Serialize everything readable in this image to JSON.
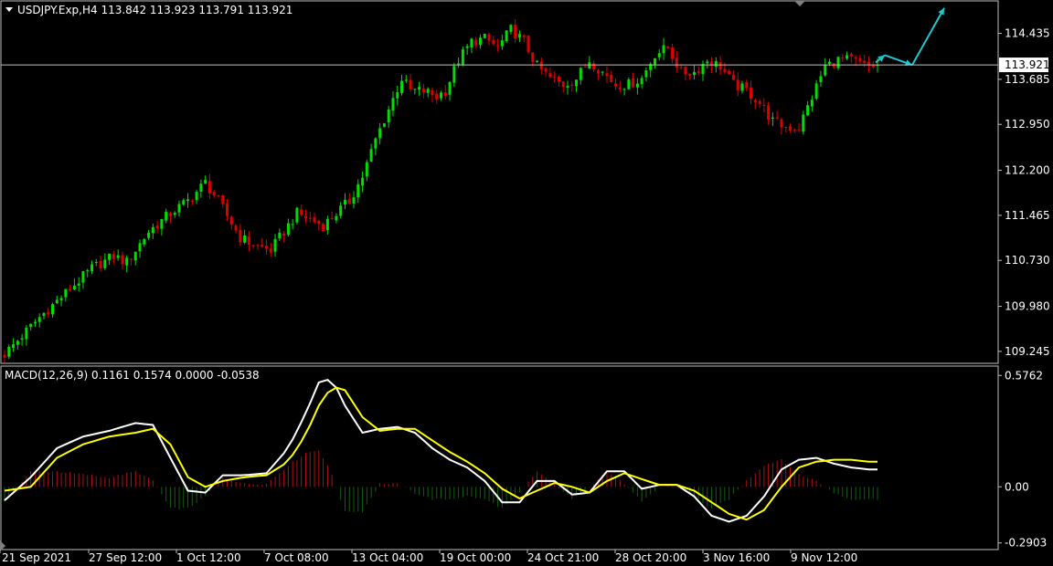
{
  "header": {
    "symbol_line": "USDJPY.Exp,H4  113.842 113.923 113.791 113.921"
  },
  "macd_header": "MACD(12,26,9) 0.1161 0.1574 0.0000 -0.0538",
  "price_label": "113.921",
  "colors": {
    "background": "#000000",
    "bull": "#00dd00",
    "bear": "#dd0000",
    "grid": "#c0c0c0",
    "arrow": "#1ec8d2",
    "macd_line": "#ffffff",
    "signal_line": "#ffff00",
    "hist_pos": "#b01010",
    "hist_neg": "#106010"
  },
  "chart_data": [
    {
      "type": "candlestick",
      "price_ticks": [
        "114.435",
        "113.685",
        "112.950",
        "112.200",
        "111.465",
        "110.730",
        "109.980",
        "109.245"
      ],
      "x_ticks": [
        "21 Sep 2021",
        "27 Sep 12:00",
        "1 Oct 12:00",
        "7 Oct 08:00",
        "13 Oct 04:00",
        "19 Oct 00:00",
        "24 Oct 21:00",
        "28 Oct 20:00",
        "3 Nov 16:00",
        "9 Nov 12:00"
      ],
      "ylim": [
        109.05,
        114.95
      ],
      "current_price": 113.921,
      "close_path": [
        [
          0,
          109.2
        ],
        [
          8,
          109.8
        ],
        [
          14,
          110.2
        ],
        [
          20,
          110.6
        ],
        [
          25,
          110.8
        ],
        [
          28,
          110.7
        ],
        [
          33,
          111.2
        ],
        [
          38,
          111.5
        ],
        [
          42,
          111.7
        ],
        [
          46,
          112.0
        ],
        [
          49,
          111.7
        ],
        [
          54,
          111.1
        ],
        [
          58,
          110.95
        ],
        [
          61,
          110.9
        ],
        [
          63,
          111.1
        ],
        [
          67,
          111.5
        ],
        [
          70,
          111.4
        ],
        [
          73,
          111.3
        ],
        [
          76,
          111.5
        ],
        [
          79,
          111.7
        ],
        [
          82,
          112.1
        ],
        [
          85,
          112.7
        ],
        [
          88,
          113.2
        ],
        [
          91,
          113.7
        ],
        [
          93,
          113.5
        ],
        [
          96,
          113.5
        ],
        [
          99,
          113.4
        ],
        [
          101,
          113.5
        ],
        [
          104,
          114.0
        ],
        [
          107,
          114.3
        ],
        [
          110,
          114.35
        ],
        [
          113,
          114.2
        ],
        [
          116,
          114.5
        ],
        [
          119,
          114.3
        ],
        [
          122,
          113.9
        ],
        [
          125,
          113.7
        ],
        [
          128,
          113.6
        ],
        [
          131,
          113.7
        ],
        [
          134,
          114.0
        ],
        [
          137,
          113.8
        ],
        [
          140,
          113.6
        ],
        [
          143,
          113.6
        ],
        [
          146,
          113.7
        ],
        [
          149,
          114.1
        ],
        [
          152,
          114.2
        ],
        [
          155,
          113.8
        ],
        [
          158,
          113.8
        ],
        [
          161,
          114.0
        ],
        [
          164,
          113.9
        ],
        [
          167,
          113.6
        ],
        [
          170,
          113.5
        ],
        [
          173,
          113.3
        ],
        [
          176,
          113.0
        ],
        [
          179,
          112.9
        ],
        [
          182,
          112.9
        ],
        [
          185,
          113.4
        ],
        [
          188,
          113.9
        ],
        [
          191,
          114.0
        ],
        [
          194,
          114.0
        ],
        [
          197,
          113.9
        ],
        [
          200,
          113.9
        ]
      ],
      "forecast_arrows": [
        [
          113.96,
          114.08
        ],
        [
          114.08,
          113.92
        ],
        [
          113.92,
          114.85
        ]
      ]
    },
    {
      "type": "line",
      "title": "MACD(12,26,9)",
      "y_ticks": [
        "0.5762",
        "0.00",
        "-0.2903"
      ],
      "ylim": [
        -0.32,
        0.62
      ],
      "macd_path": [
        [
          0,
          -0.07
        ],
        [
          6,
          0.05
        ],
        [
          12,
          0.2
        ],
        [
          18,
          0.26
        ],
        [
          24,
          0.29
        ],
        [
          30,
          0.33
        ],
        [
          34,
          0.32
        ],
        [
          38,
          0.15
        ],
        [
          42,
          -0.02
        ],
        [
          46,
          -0.03
        ],
        [
          50,
          0.06
        ],
        [
          55,
          0.06
        ],
        [
          60,
          0.07
        ],
        [
          65,
          0.2
        ],
        [
          69,
          0.38
        ],
        [
          72,
          0.54
        ],
        [
          75,
          0.56
        ],
        [
          78,
          0.42
        ],
        [
          82,
          0.28
        ],
        [
          86,
          0.3
        ],
        [
          90,
          0.31
        ],
        [
          94,
          0.28
        ],
        [
          98,
          0.2
        ],
        [
          102,
          0.14
        ],
        [
          106,
          0.1
        ],
        [
          110,
          0.03
        ],
        [
          114,
          -0.08
        ],
        [
          118,
          -0.08
        ],
        [
          122,
          0.03
        ],
        [
          126,
          0.03
        ],
        [
          130,
          -0.04
        ],
        [
          134,
          -0.03
        ],
        [
          138,
          0.08
        ],
        [
          142,
          0.08
        ],
        [
          146,
          -0.01
        ],
        [
          150,
          0.01
        ],
        [
          154,
          0.01
        ],
        [
          158,
          -0.05
        ],
        [
          162,
          -0.15
        ],
        [
          166,
          -0.18
        ],
        [
          170,
          -0.15
        ],
        [
          174,
          -0.05
        ],
        [
          178,
          0.09
        ],
        [
          182,
          0.14
        ],
        [
          186,
          0.15
        ],
        [
          190,
          0.12
        ],
        [
          194,
          0.1
        ],
        [
          198,
          0.09
        ]
      ],
      "signal_path": [
        [
          0,
          -0.02
        ],
        [
          6,
          0.0
        ],
        [
          12,
          0.15
        ],
        [
          18,
          0.22
        ],
        [
          24,
          0.26
        ],
        [
          30,
          0.28
        ],
        [
          34,
          0.3
        ],
        [
          38,
          0.22
        ],
        [
          42,
          0.05
        ],
        [
          46,
          0.0
        ],
        [
          50,
          0.03
        ],
        [
          55,
          0.05
        ],
        [
          60,
          0.06
        ],
        [
          65,
          0.13
        ],
        [
          69,
          0.27
        ],
        [
          72,
          0.42
        ],
        [
          75,
          0.52
        ],
        [
          78,
          0.5
        ],
        [
          82,
          0.36
        ],
        [
          86,
          0.29
        ],
        [
          90,
          0.3
        ],
        [
          94,
          0.3
        ],
        [
          98,
          0.24
        ],
        [
          102,
          0.18
        ],
        [
          106,
          0.13
        ],
        [
          110,
          0.07
        ],
        [
          114,
          -0.01
        ],
        [
          118,
          -0.06
        ],
        [
          122,
          -0.02
        ],
        [
          126,
          0.02
        ],
        [
          130,
          0.0
        ],
        [
          134,
          -0.03
        ],
        [
          138,
          0.03
        ],
        [
          142,
          0.07
        ],
        [
          146,
          0.04
        ],
        [
          150,
          0.01
        ],
        [
          154,
          0.01
        ],
        [
          158,
          -0.02
        ],
        [
          162,
          -0.08
        ],
        [
          166,
          -0.14
        ],
        [
          170,
          -0.17
        ],
        [
          174,
          -0.12
        ],
        [
          178,
          0.0
        ],
        [
          182,
          0.1
        ],
        [
          186,
          0.13
        ],
        [
          190,
          0.14
        ],
        [
          194,
          0.14
        ],
        [
          198,
          0.13
        ]
      ]
    }
  ]
}
